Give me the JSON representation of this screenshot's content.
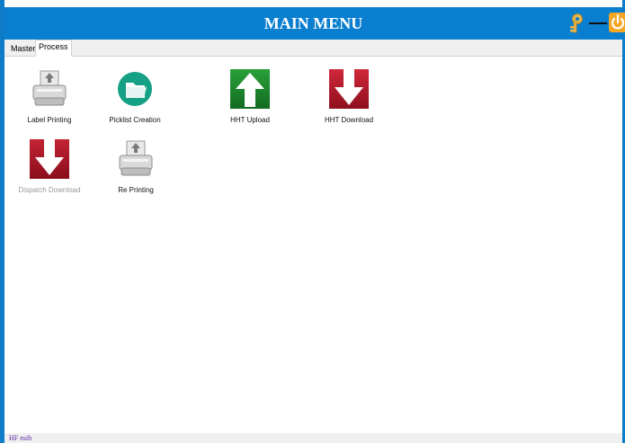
{
  "window": {
    "title": "MAIN MENU"
  },
  "colors": {
    "titlebar": "#0a7fd0",
    "border": "#0f7cc9",
    "upload_green": "#1f8a2e",
    "download_red": "#b0182a",
    "pickist_teal": "#16a085",
    "power_orange": "#f39c12",
    "key_gold": "#e8b84a"
  },
  "titlebar": {
    "key_icon": "key-icon",
    "minimize_icon": "minimize-icon",
    "power_icon": "power-icon"
  },
  "tabs": [
    {
      "label": "Master",
      "active": false
    },
    {
      "label": "Process",
      "active": true
    }
  ],
  "tiles": [
    {
      "label": "Label Printing",
      "icon": "printer-icon",
      "enabled": true
    },
    {
      "label": "Picklist Creation",
      "icon": "folder-icon",
      "enabled": true
    },
    {
      "label": "HHT Upload",
      "icon": "upload-arrow-icon",
      "enabled": true
    },
    {
      "label": "HHT Download",
      "icon": "download-arrow-icon",
      "enabled": true
    },
    {
      "label": "Dispatch Download",
      "icon": "download-arrow-icon",
      "enabled": false
    },
    {
      "label": "Re Printing",
      "icon": "printer-icon",
      "enabled": true
    }
  ],
  "status": {
    "text": "HF ruih"
  }
}
